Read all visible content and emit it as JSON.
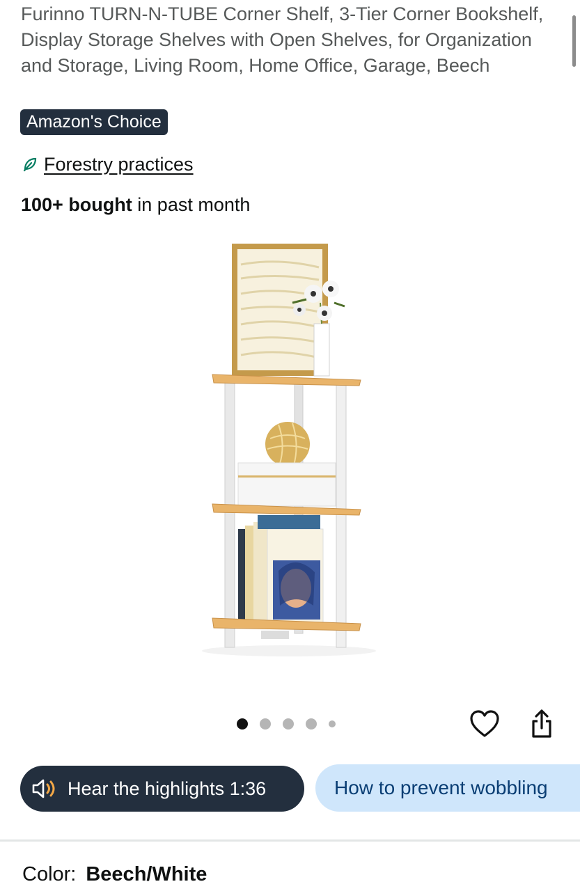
{
  "product": {
    "title": "Furinno TURN-N-TUBE Corner Shelf, 3-Tier Corner Bookshelf, Display Storage Shelves with Open Shelves, for Organization and Storage, Living Room, Home Office, Garage, Beech",
    "badge": "Amazon's Choice",
    "sustainability_link": "Forestry practices",
    "sustainability_icon": "leaf-icon",
    "bought_bold": "100+ bought",
    "bought_rest": " in past month"
  },
  "gallery": {
    "image_count": 5,
    "active_index": 0,
    "wishlist_icon": "heart-icon",
    "share_icon": "share-icon"
  },
  "chips": {
    "audio_label": "Hear the highlights 1:36",
    "audio_icon": "speaker-icon",
    "question_label": "How to prevent wobbling"
  },
  "variation": {
    "label": "Color:",
    "value": "Beech/White"
  },
  "colors": {
    "badge_bg": "#232f3e",
    "chip_light_bg": "#cfe6fb",
    "link_text": "#0a3e74",
    "leaf": "#067d62"
  }
}
